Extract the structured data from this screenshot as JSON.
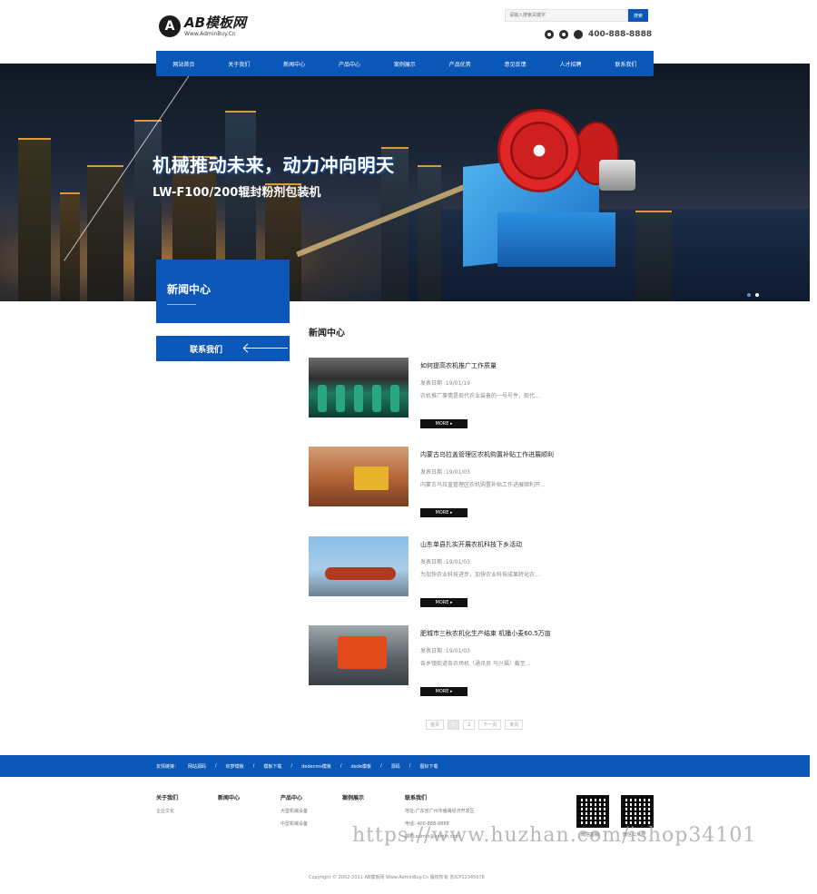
{
  "header": {
    "logo_letter": "A",
    "logo_title": "AB模板网",
    "logo_sub": "Www.AdminBuy.Cn",
    "search_placeholder": "请输入搜索关键字",
    "search_button": "搜索",
    "phone": "400-888-8888"
  },
  "nav": {
    "items": [
      "网站首页",
      "关于我们",
      "新闻中心",
      "产品中心",
      "案例展示",
      "产品优势",
      "意见反馈",
      "人才招聘",
      "联系我们"
    ]
  },
  "banner": {
    "title": "机械推动未来，动力冲向明天",
    "subtitle": "LW-F100/200辊封粉剂包装机"
  },
  "sidebar": {
    "title": "新闻中心",
    "contact": "联系我们"
  },
  "main": {
    "title": "新闻中心",
    "more_label": "MORE ▸",
    "news": [
      {
        "title": "如何提高农机推广工作质量",
        "date": "发表日期 :19/01/19",
        "desc": "农机推广事情是现代农业装备的一号号件，现代..."
      },
      {
        "title": "内蒙古乌拉盖管理区农机购置补贴工作进展顺利",
        "date": "发表日期 :19/01/03",
        "desc": "内蒙古乌拉盖管理区农机购置补贴工作进展顺利开..."
      },
      {
        "title": "山东单县扎实开展农机科技下乡活动",
        "date": "发表日期 :19/01/03",
        "desc": "为加快农业科技进步，加快农业科技成果转化农..."
      },
      {
        "title": "肥城市三秋农机化生产结束 机播小麦60.5万亩",
        "date": "发表日期 :19/01/03",
        "desc": "各乡镇街道各农场机（通讯员 马兴福）截至..."
      }
    ]
  },
  "pagination": {
    "items": [
      "首页",
      "1",
      "2",
      "下一页",
      "末页"
    ]
  },
  "friend_links": {
    "label": "友情链接：",
    "items": [
      "网站源码",
      "织梦模板",
      "模板下载",
      "dedecms模板",
      "dede模板",
      "源码",
      "图标下载"
    ]
  },
  "footer": {
    "columns": [
      {
        "head": "关于我们",
        "links": [
          "企业文化"
        ]
      },
      {
        "head": "新闻中心",
        "links": []
      },
      {
        "head": "产品中心",
        "links": [
          "大型机械设备",
          "中型机械设备"
        ]
      },
      {
        "head": "案例展示",
        "links": []
      },
      {
        "head": "联系我们",
        "links": [
          "地址:广东省广州市番禺经济开发区",
          "电话: 400-888-8888",
          "邮箱:admin@admin.com"
        ]
      }
    ],
    "qr_labels": [
      "微信客服",
      "微信公众号"
    ],
    "copyright": "Copyright © 2002-2011 AB模板网 Www.AdminBuy.Cn 版权所有    苏ICP12345678"
  },
  "watermark": "https://www.huzhan.com/ishop34101"
}
